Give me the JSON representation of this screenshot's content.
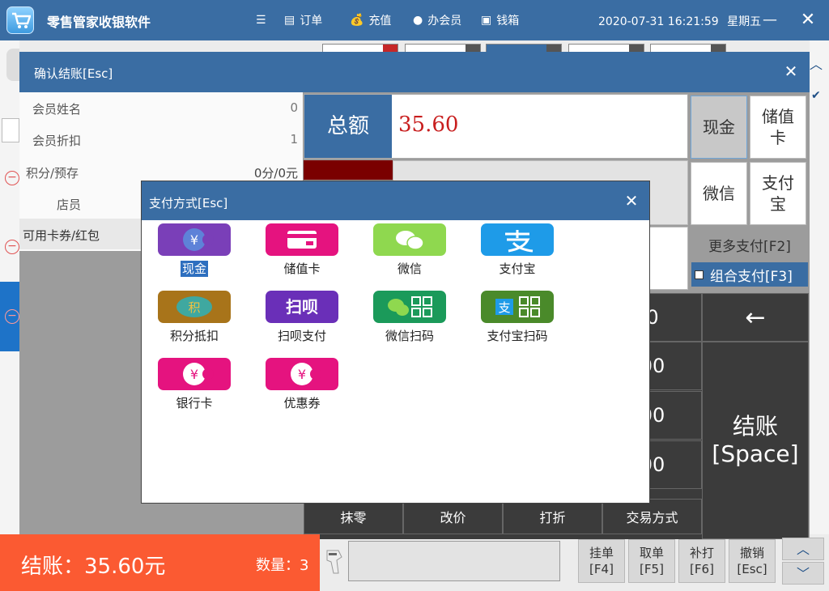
{
  "app": {
    "title": "零售管家收银软件",
    "datetime": "2020-07-31 16:21:59",
    "weekday": "星期五",
    "nav": [
      {
        "label": "订单",
        "icon": "document-icon"
      },
      {
        "label": "充值",
        "icon": "money-bag-icon"
      },
      {
        "label": "办会员",
        "icon": "user-icon"
      },
      {
        "label": "钱箱",
        "icon": "cash-drawer-icon"
      }
    ]
  },
  "confirm_dialog": {
    "title": "确认结账[Esc]",
    "member_name_label": "会员姓名",
    "member_name_value": "0",
    "member_discount_label": "会员折扣",
    "member_discount_value": "1",
    "points_label": "积分/预存",
    "points_value": "0分/0元",
    "clerk_label": "店员",
    "coupon_label": "可用卡券/红包",
    "amount_label": "总额",
    "amount_value": "35.60",
    "quick_pay": [
      {
        "label": "现金",
        "selected": true
      },
      {
        "label": "储值卡",
        "selected": false
      },
      {
        "label": "微信",
        "selected": false
      },
      {
        "label": "支付宝",
        "selected": false
      }
    ],
    "more_pay": "更多支付[F2]",
    "combo_pay": "组合支付[F3]",
    "keypad": {
      "keys_partial": [
        "0",
        "00",
        "00",
        "00"
      ],
      "backspace": "←",
      "bottom": [
        "抹零",
        "改价",
        "打折",
        "交易方式"
      ],
      "checkout_line1": "结账",
      "checkout_line2": "[Space]"
    }
  },
  "payment_dialog": {
    "title": "支付方式[Esc]",
    "methods": [
      {
        "label": "现金",
        "icon": "cash-yuan-icon",
        "color": "#7a3fb8",
        "selected": true
      },
      {
        "label": "储值卡",
        "icon": "stored-value-card-icon",
        "color": "#e5137f",
        "selected": false
      },
      {
        "label": "微信",
        "icon": "wechat-icon",
        "color": "#8fd84f",
        "selected": false
      },
      {
        "label": "支付宝",
        "icon": "alipay-icon",
        "color": "#1e9be8",
        "selected": false
      },
      {
        "label": "积分抵扣",
        "icon": "points-icon",
        "color": "#a8741a",
        "selected": false
      },
      {
        "label": "扫呗支付",
        "icon": "saobei-icon",
        "color": "#6a2fb8",
        "selected": false
      },
      {
        "label": "微信扫码",
        "icon": "wechat-qr-icon",
        "color": "#1b9a5a",
        "selected": false
      },
      {
        "label": "支付宝扫码",
        "icon": "alipay-qr-icon",
        "color": "#4a8a2a",
        "selected": false
      },
      {
        "label": "银行卡",
        "icon": "bank-card-icon",
        "color": "#e5137f",
        "selected": false
      },
      {
        "label": "优惠券",
        "icon": "coupon-icon",
        "color": "#e5137f",
        "selected": false
      }
    ]
  },
  "bottom_bar": {
    "total_text": "结账：35.60元",
    "qty_text": "数量：3",
    "fkeys": [
      {
        "line1": "挂单",
        "line2": "[F4]"
      },
      {
        "line1": "取单",
        "line2": "[F5]"
      },
      {
        "line1": "补打",
        "line2": "[F6]"
      },
      {
        "line1": "撤销",
        "line2": "[Esc]"
      }
    ]
  }
}
